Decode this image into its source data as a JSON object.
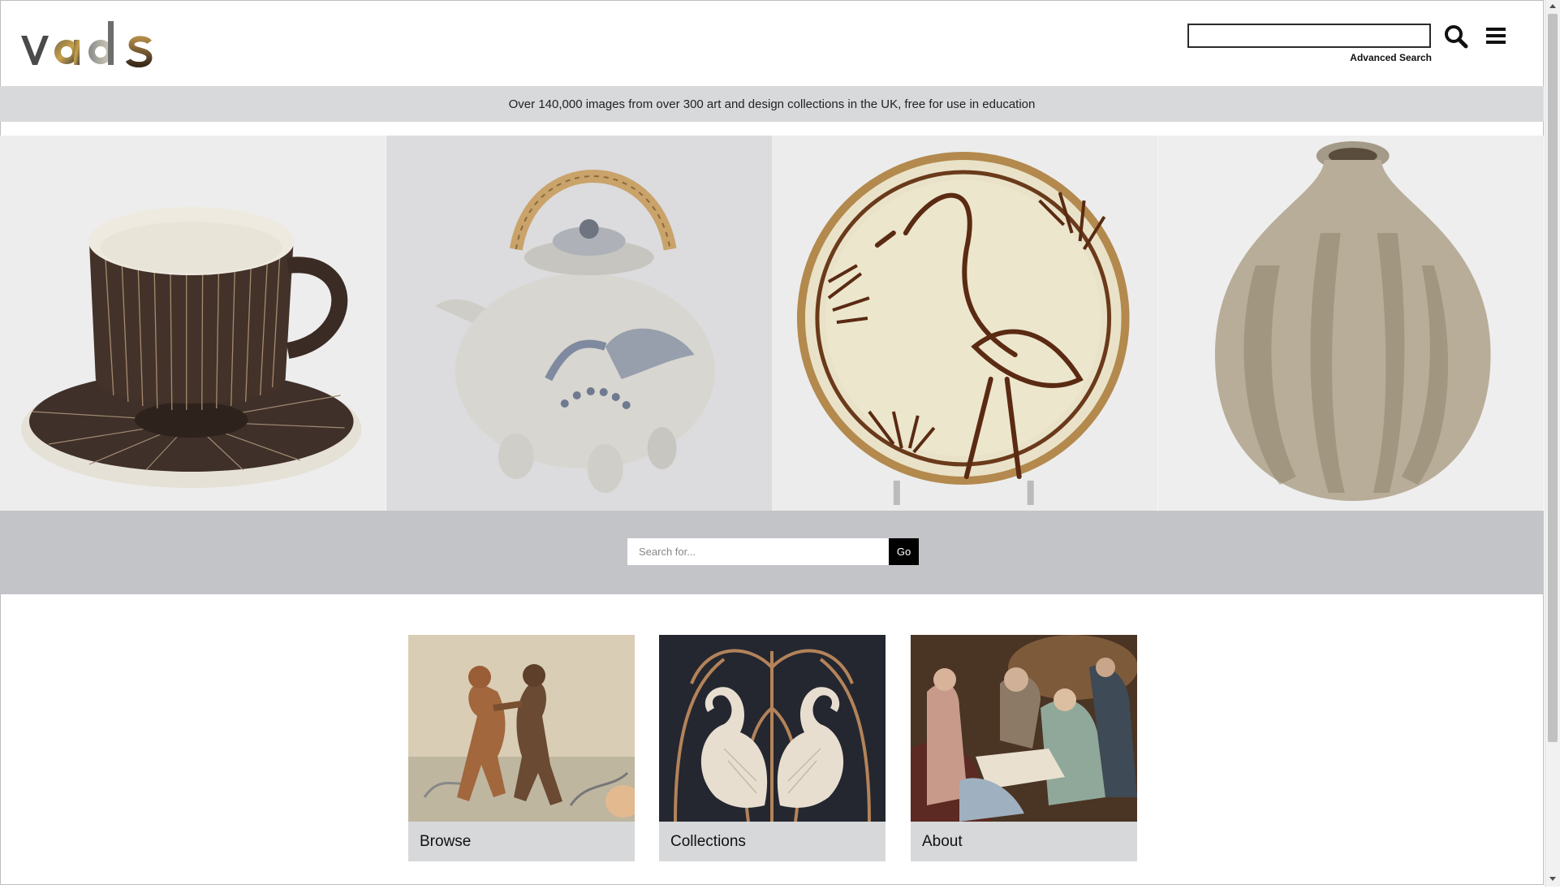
{
  "header": {
    "logo_text": "vads",
    "search_value": "",
    "advanced_search_label": "Advanced Search",
    "search_icon": "search-icon",
    "menu_icon": "hamburger-menu-icon"
  },
  "banner": {
    "text": "Over 140,000 images from over 300 art and design collections in the UK, free for use in education"
  },
  "hero": {
    "images": [
      "cup-and-saucer-image",
      "teapot-image",
      "heron-plate-image",
      "vase-image"
    ]
  },
  "search": {
    "placeholder": "Search for...",
    "go_label": "Go"
  },
  "cards": [
    {
      "label": "Browse",
      "image": "dancing-dogs-image"
    },
    {
      "label": "Collections",
      "image": "swans-image"
    },
    {
      "label": "About",
      "image": "painting-image"
    }
  ],
  "colors": {
    "banner_bg": "#d8d9db",
    "search_band_bg": "#c3c4c7",
    "card_bg": "#d7d8da",
    "button_bg": "#000000"
  }
}
